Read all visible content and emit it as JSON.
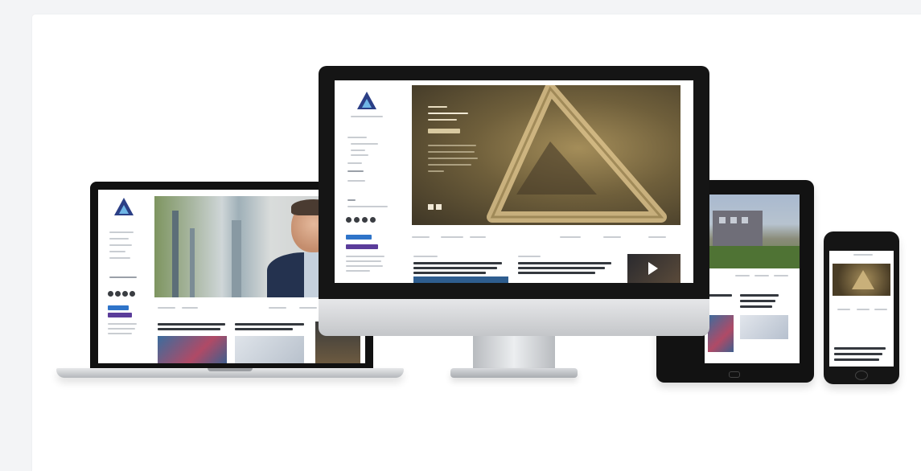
{
  "image": {
    "type": "responsive-design-mockup",
    "devices": [
      "laptop",
      "desktop-monitor",
      "tablet",
      "phone"
    ],
    "colors": {
      "brand_navy": "#2b3f86",
      "brand_light_blue": "#6fb6e6",
      "hero_gold": "#8a7446",
      "accent_blue": "#2f74c9",
      "accent_purple": "#5a3c9a"
    },
    "icons": [
      "triangle-logo-icon",
      "play-icon"
    ]
  }
}
